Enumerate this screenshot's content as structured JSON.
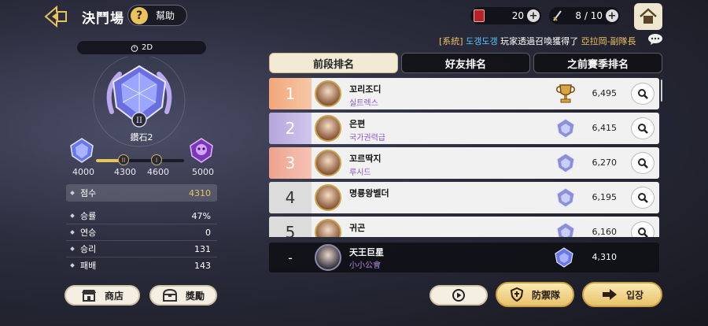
{
  "header": {
    "title": "決鬥場",
    "help_label": "幫助",
    "help_glyph": "?",
    "ticket_value": "20",
    "sword_value": "8 / 10",
    "plus_glyph": "+"
  },
  "marquee": {
    "system": "[系統]",
    "name": "도갱도갱",
    "text": "玩家透過召喚獲得了",
    "item": "亞拉岡-副隊長"
  },
  "rank_panel": {
    "season": "2D",
    "tier_name": "鑽石2",
    "progress_fraction": 0.28,
    "ticks": [
      "4000",
      "4300",
      "4600",
      "5000"
    ],
    "mark_1": "II",
    "mark_2": "I",
    "stats": [
      {
        "label": "점수",
        "value": "4310",
        "highlight": true
      },
      {
        "label": "승률",
        "value": "47%"
      },
      {
        "label": "연승",
        "value": "0"
      },
      {
        "label": "승리",
        "value": "131"
      },
      {
        "label": "패배",
        "value": "143"
      }
    ],
    "shop_label": "商店",
    "reward_label": "獎勵"
  },
  "tabs": [
    "前段排名",
    "好友排名",
    "之前賽季排名"
  ],
  "ranking": [
    {
      "rank": "1",
      "name": "꼬리조디",
      "guild": "실트렉스",
      "score": "6,495",
      "badge": "trophy"
    },
    {
      "rank": "2",
      "name": "은편",
      "guild": "국가권력급",
      "score": "6,415",
      "badge": "diamond-crown"
    },
    {
      "rank": "3",
      "name": "꼬르딱지",
      "guild": "루시드",
      "score": "6,270",
      "badge": "diamond-crown"
    },
    {
      "rank": "4",
      "name": "명룡왕벨더",
      "guild": "",
      "score": "6,195",
      "badge": "diamond-crown"
    },
    {
      "rank": "5",
      "name": "귀곤",
      "guild": "",
      "score": "6,160",
      "badge": "diamond-crown"
    }
  ],
  "my_entry": {
    "rank": "-",
    "name": "天王巨星",
    "guild": "小小公會",
    "score": "4,310"
  },
  "bottom": {
    "defense_label": "防禦隊",
    "enter_label": "입장"
  },
  "colors": {
    "accent_gold": "#e8c25a",
    "guild_purple": "#8a55c8",
    "marquee_name": "#58c7ff"
  }
}
